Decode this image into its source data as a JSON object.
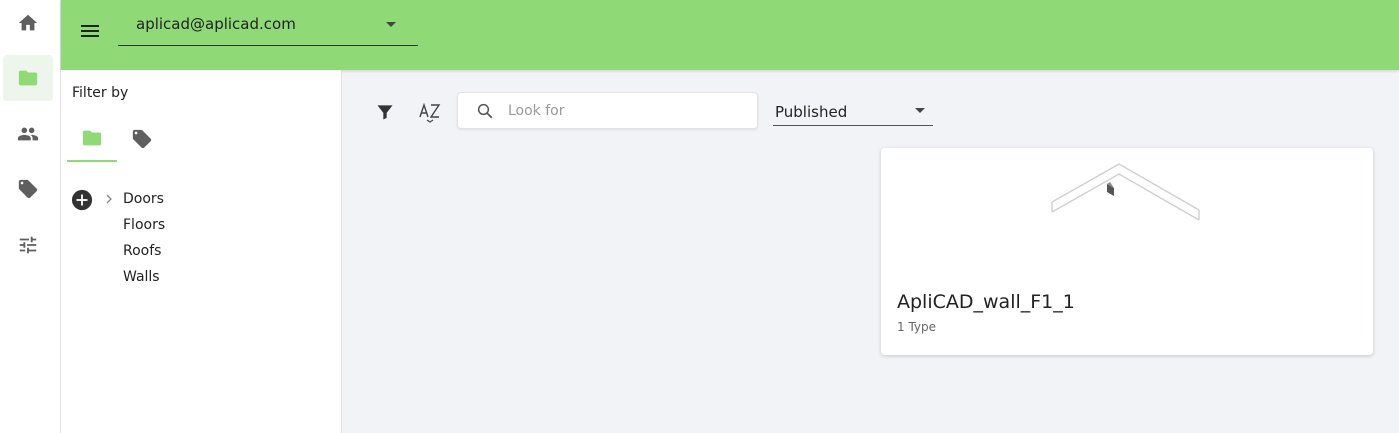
{
  "rail": {
    "items": [
      {
        "icon": "home-icon"
      },
      {
        "icon": "folder-icon",
        "active": true
      },
      {
        "icon": "people-icon"
      },
      {
        "icon": "tag-icon"
      },
      {
        "icon": "sliders-icon"
      }
    ]
  },
  "header": {
    "account": "aplicad@aplicad.com",
    "accent_color": "#90d977"
  },
  "filter": {
    "title": "Filter by",
    "tabs": [
      {
        "icon": "folder-icon",
        "active": true
      },
      {
        "icon": "tag-icon",
        "active": false
      }
    ],
    "tree": [
      {
        "label": "Doors",
        "expandable": true
      },
      {
        "label": "Floors"
      },
      {
        "label": "Roofs"
      },
      {
        "label": "Walls"
      }
    ]
  },
  "toolbar": {
    "search_placeholder": "Look for",
    "search_value": "",
    "status": "Published"
  },
  "results": [
    {
      "title": "ApliCAD_wall_F1_1",
      "subtitle": "1 Type"
    }
  ]
}
